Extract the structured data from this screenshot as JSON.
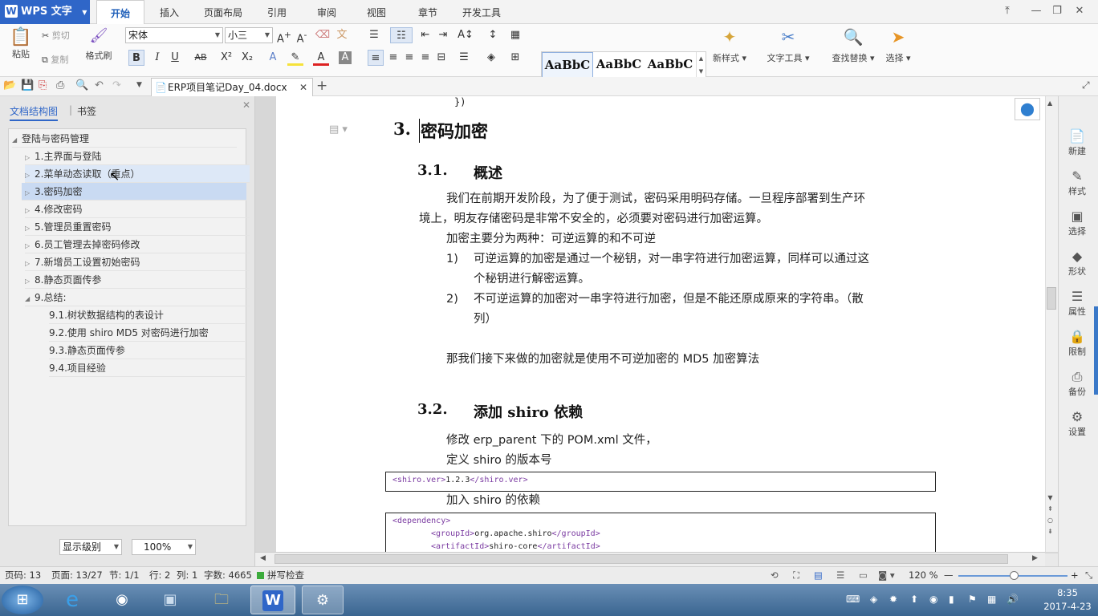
{
  "app": {
    "logo": "WPS 文字",
    "logo_letter": "W"
  },
  "menu_tabs": [
    "开始",
    "插入",
    "页面布局",
    "引用",
    "审阅",
    "视图",
    "章节",
    "开发工具"
  ],
  "window_controls": [
    "⤒",
    "—",
    "❐",
    "✕"
  ],
  "ribbon": {
    "paste": "粘贴",
    "cut": "剪切",
    "copy": "复制",
    "format_painter": "格式刷",
    "font_name": "宋体",
    "font_size": "小三",
    "bold": "B",
    "italic": "I",
    "underline": "U",
    "strike": "AB",
    "superscript": "X²",
    "subscript": "X₂",
    "styles": [
      {
        "sample": "AaBbC",
        "name": "H2"
      },
      {
        "sample": "AaBbC",
        "name": "H3"
      },
      {
        "sample": "AaBbC",
        "name": "H4"
      }
    ],
    "new_style": "新样式",
    "text_tools": "文字工具",
    "find_replace": "查找替换",
    "select": "选择"
  },
  "doc_tab": {
    "title": "ERP项目笔记Day_04.docx",
    "close": "✕",
    "add": "+"
  },
  "nav": {
    "tab_outline": "文档结构图",
    "tab_bookmark": "书签",
    "tree": [
      {
        "label": "登陆与密码管理",
        "level": 0,
        "expanded": true
      },
      {
        "label": "1.主界面与登陆",
        "level": 1
      },
      {
        "label": "2.菜单动态读取（重点）",
        "level": 1
      },
      {
        "label": "3.密码加密",
        "level": 1,
        "selected": true
      },
      {
        "label": "4.修改密码",
        "level": 1
      },
      {
        "label": "5.管理员重置密码",
        "level": 1
      },
      {
        "label": "6.员工管理去掉密码修改",
        "level": 1
      },
      {
        "label": "7.新增员工设置初始密码",
        "level": 1
      },
      {
        "label": "8.静态页面传参",
        "level": 1
      },
      {
        "label": "9.总结:",
        "level": 1,
        "expanded": true
      },
      {
        "label": "9.1.树状数据结构的表设计",
        "level": 2
      },
      {
        "label": "9.2.使用 shiro MD5 对密码进行加密",
        "level": 2
      },
      {
        "label": "9.3.静态页面传参",
        "level": 2
      },
      {
        "label": "9.4.项目经验",
        "level": 2
      }
    ],
    "level_select": "显示级别",
    "zoom_select": "100%"
  },
  "doc": {
    "prev_line": "})",
    "h1_num": "3.",
    "h1": "密码加密",
    "h2a_num": "3.1.",
    "h2a": "概述",
    "para1_l1": "我们在前期开发阶段，为了便于测试，密码采用明码存储。一旦程序部署到生产环",
    "para1_l2": "境上，明友存储密码是非常不安全的，必须要对密码进行加密运算。",
    "para2": "加密主要分为两种：可逆运算的和不可逆",
    "li1_num": "1)",
    "li1_l1": "可逆运算的加密是通过一个秘钥，对一串字符进行加密运算，同样可以通过这",
    "li1_l2": "个秘钥进行解密运算。",
    "li2_num": "2)",
    "li2_l1": "不可逆运算的加密对一串字符进行加密，但是不能还原成原来的字符串。（散",
    "li2_l2": "列）",
    "para3": "那我们接下来做的加密就是使用不可逆加密的 MD5 加密算法",
    "h2b_num": "3.2.",
    "h2b": "添加 shiro 依赖",
    "para4": "修改 erp_parent 下的 POM.xml 文件，",
    "para5": "定义 shiro 的版本号",
    "code1_open": "<shiro.ver>",
    "code1_val": "1.2.3",
    "code1_close": "</shiro.ver>",
    "para6": "加入 shiro 的依赖",
    "code2_l1": "<dependency>",
    "code2_l2_open": "<groupId>",
    "code2_l2_val": "org.apache.shiro",
    "code2_l2_close": "</groupId>",
    "code2_l3_open": "<artifactId>",
    "code2_l3_val": "shiro-core",
    "code2_l3_close": "</artifactId>"
  },
  "right_pane": [
    {
      "icon": "📄",
      "label": "新建"
    },
    {
      "icon": "✎",
      "label": "样式"
    },
    {
      "icon": "▣",
      "label": "选择"
    },
    {
      "icon": "◆",
      "label": "形状"
    },
    {
      "icon": "☰",
      "label": "属性"
    },
    {
      "icon": "🔒",
      "label": "限制"
    },
    {
      "icon": "⎙",
      "label": "备份"
    },
    {
      "icon": "⚙",
      "label": "设置"
    }
  ],
  "status": {
    "page_num": "页码: 13",
    "page": "页面: 13/27",
    "section": "节: 1/1",
    "row": "行: 2",
    "col": "列: 1",
    "words": "字数: 4665",
    "spell": "拼写检查",
    "zoom": "120 %"
  },
  "clock": {
    "time": "8:35",
    "date": "2017-4-23"
  },
  "colors": {
    "accent": "#2f66c8",
    "selected": "#c9daf2"
  }
}
